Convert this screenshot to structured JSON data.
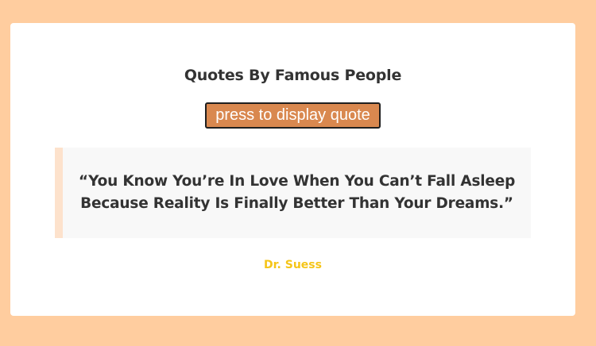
{
  "page": {
    "title": "Quotes By Famous People",
    "button_label": "press to display quote"
  },
  "quote": {
    "text": "“You Know You’re In Love When You Can’t Fall Asleep Because Reality Is Finally Better Than Your Dreams.”",
    "author": "Dr. Suess"
  },
  "colors": {
    "background": "#ffcd9f",
    "card": "#ffffff",
    "button": "#d9884f",
    "quote_box": "#f8f8f8",
    "quote_accent": "#fde2cc",
    "author": "#f5c518"
  }
}
